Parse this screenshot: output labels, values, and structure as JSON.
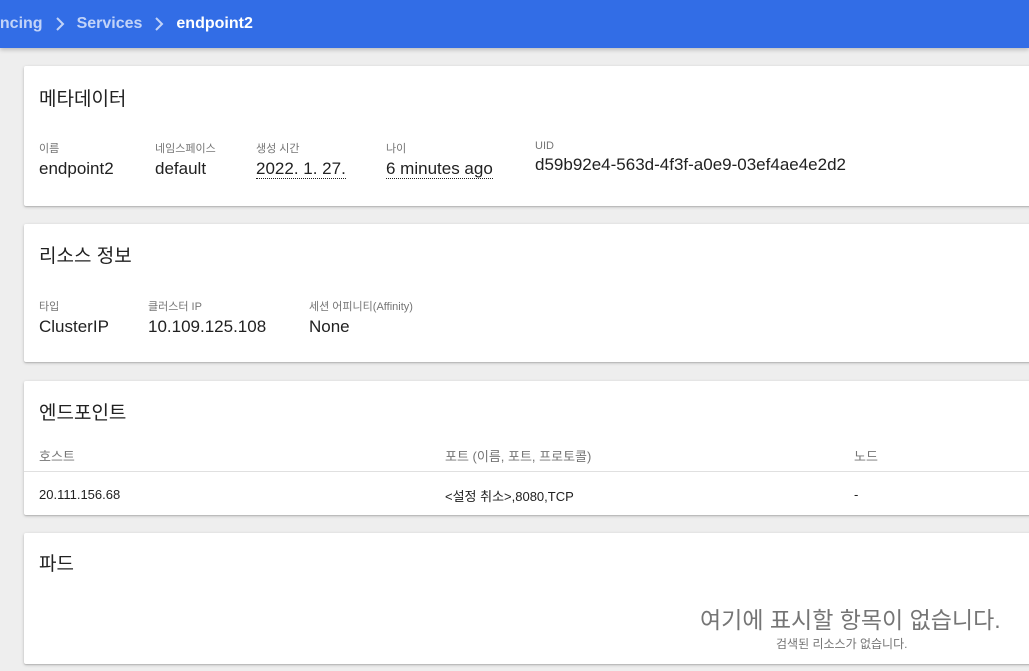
{
  "breadcrumb": {
    "items": [
      "ancing",
      "Services",
      "endpoint2"
    ]
  },
  "metadata": {
    "title": "메타데이터",
    "name_label": "이름",
    "name_value": "endpoint2",
    "namespace_label": "네임스페이스",
    "namespace_value": "default",
    "created_label": "생성 시간",
    "created_value": "2022. 1. 27.",
    "age_label": "나이",
    "age_value": "6 minutes ago",
    "uid_label": "UID",
    "uid_value": "d59b92e4-563d-4f3f-a0e9-03ef4ae4e2d2"
  },
  "resource_info": {
    "title": "리소스 정보",
    "type_label": "타입",
    "type_value": "ClusterIP",
    "cluster_ip_label": "클러스터 IP",
    "cluster_ip_value": "10.109.125.108",
    "affinity_label": "세션 어피니티(Affinity)",
    "affinity_value": "None"
  },
  "endpoints": {
    "title": "엔드포인트",
    "columns": [
      "호스트",
      "포트 (이름, 포트, 프로토콜)",
      "노드"
    ],
    "rows": [
      {
        "host": "20.111.156.68",
        "ports": "<설정 취소>,8080,TCP",
        "node": "-"
      }
    ]
  },
  "pods": {
    "title": "파드",
    "empty_title": "여기에 표시할 항목이 없습니다.",
    "empty_subtitle": "검색된 리소스가 없습니다."
  },
  "colors": {
    "topbar": "#326de6",
    "background": "#eeeeee"
  },
  "icons": {
    "breadcrumb_separator": "chevron-right-icon"
  }
}
